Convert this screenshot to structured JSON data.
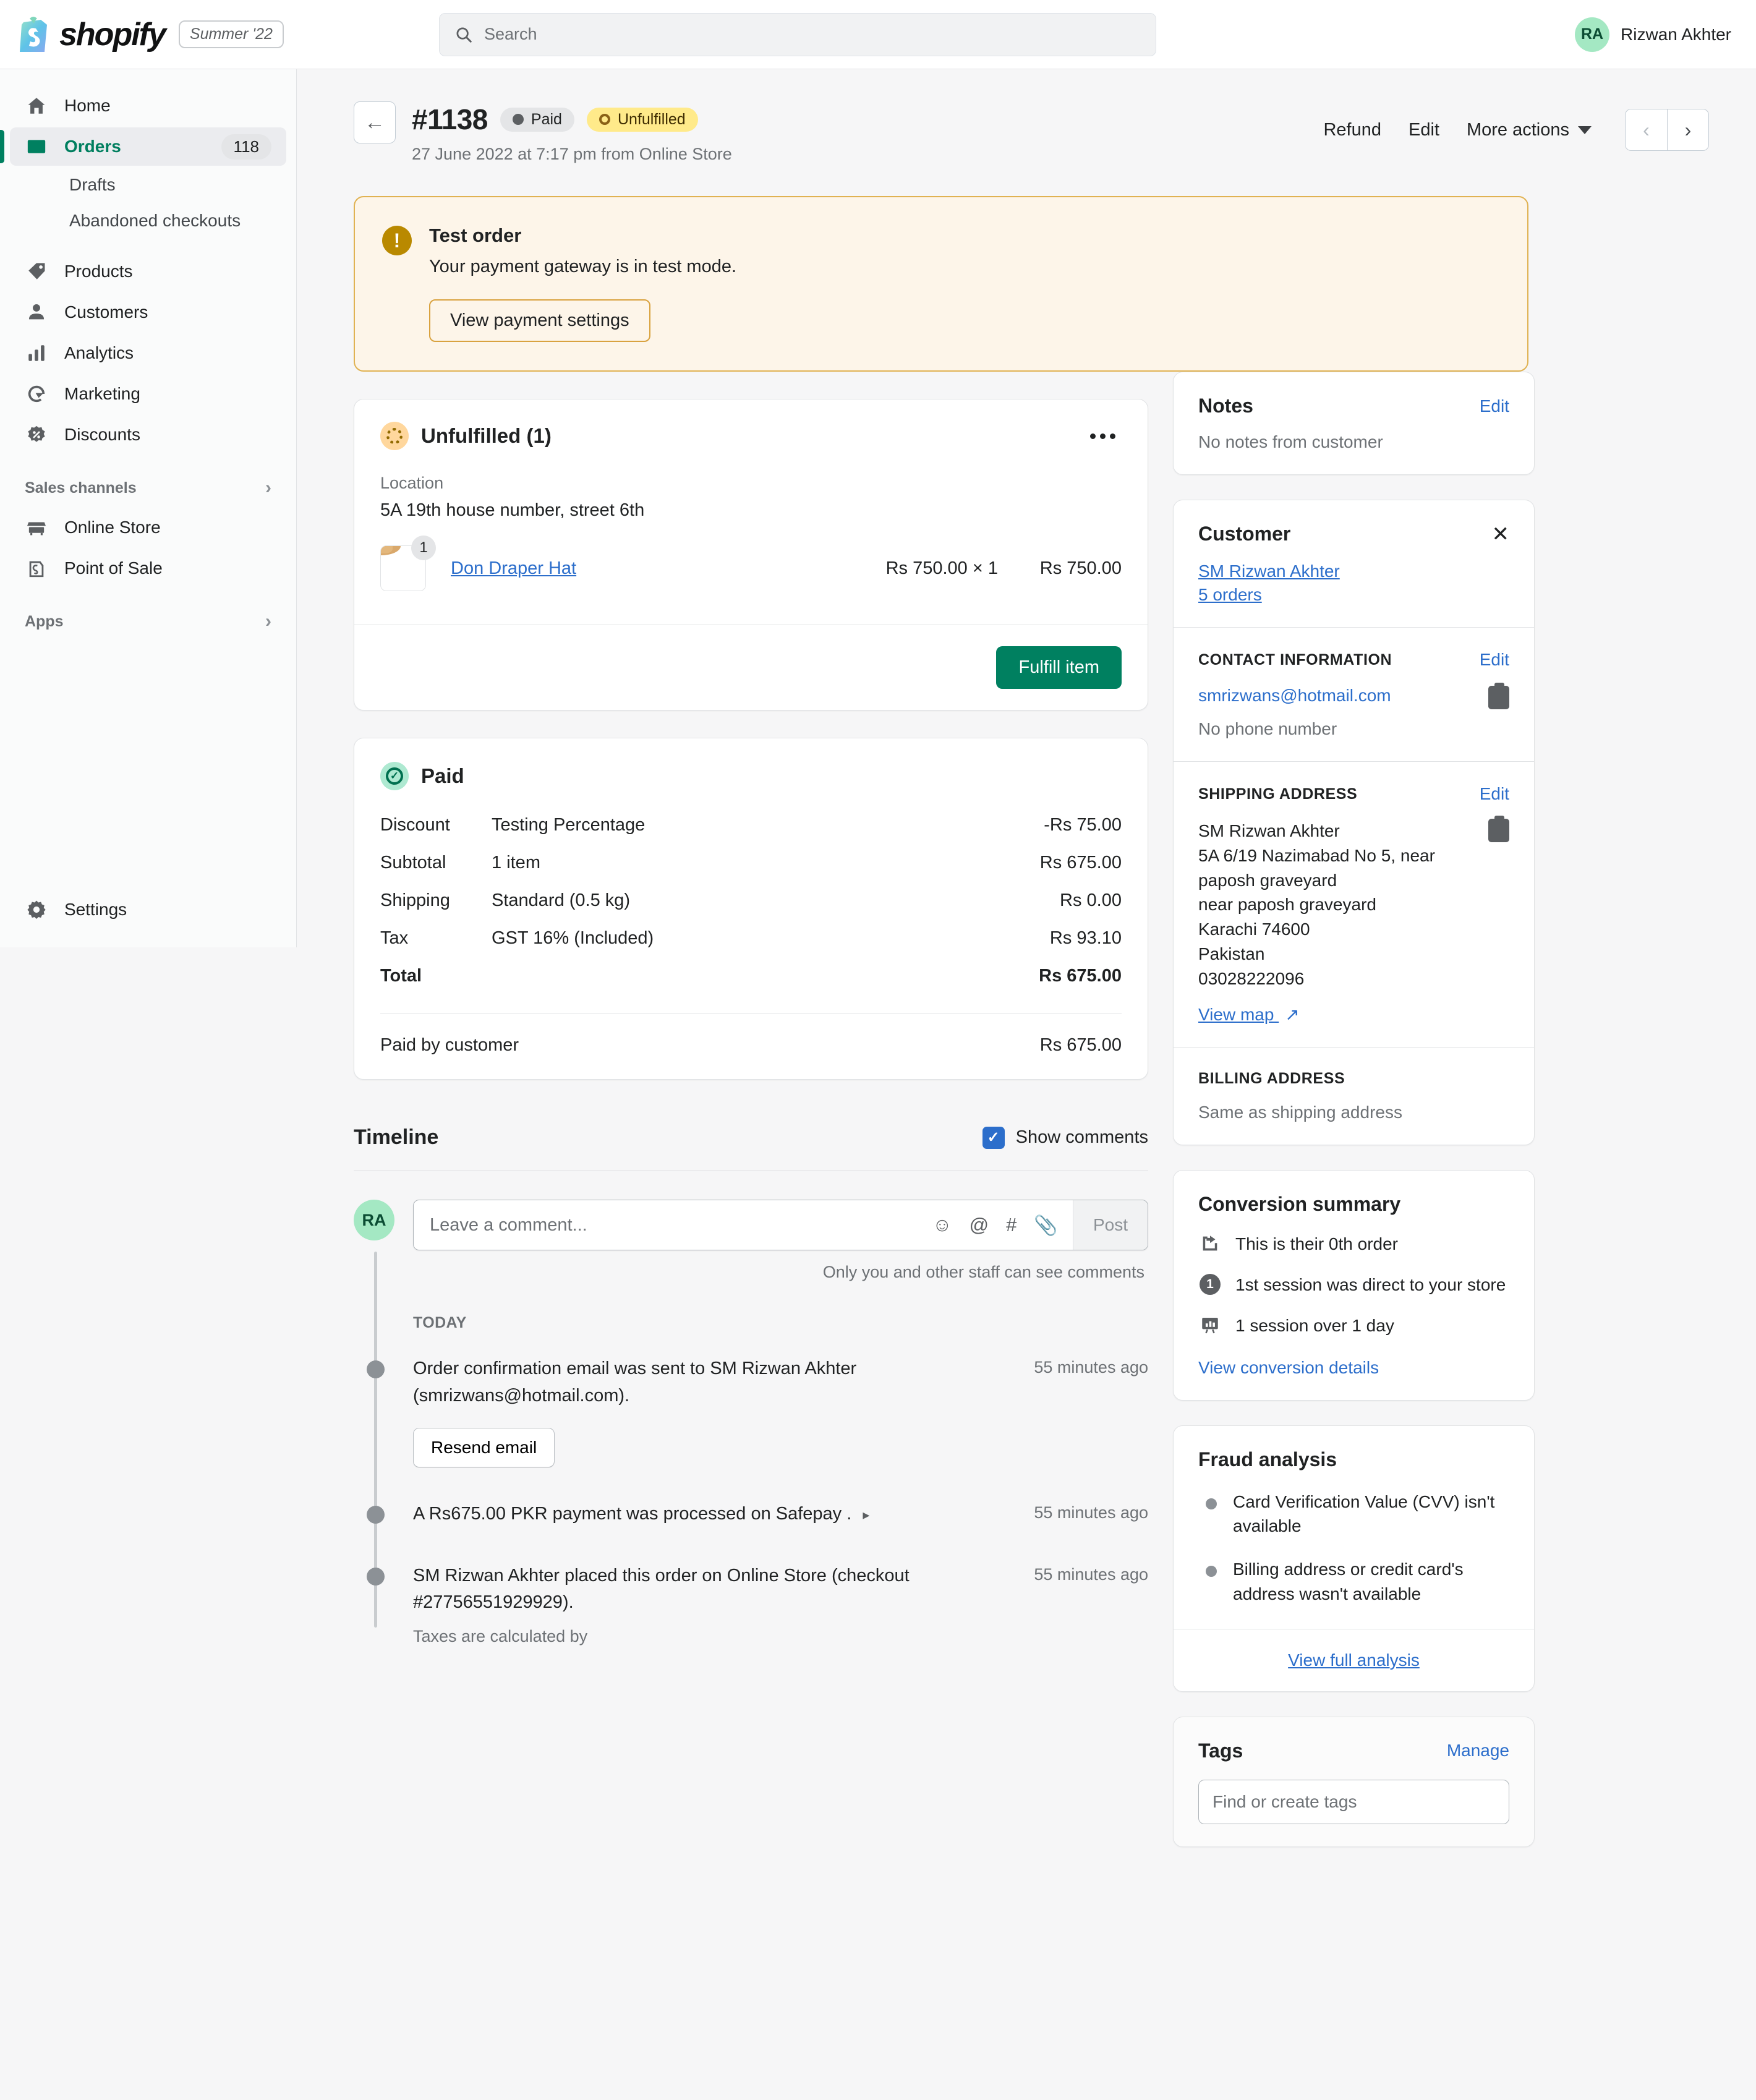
{
  "topbar": {
    "logo_word": "shopify",
    "release_pill": "Summer '22",
    "search_placeholder": "Search",
    "user_initials": "RA",
    "user_name": "Rizwan Akhter"
  },
  "sidebar": {
    "items": [
      {
        "label": "Home",
        "icon": "home-icon"
      },
      {
        "label": "Orders",
        "icon": "orders-icon",
        "badge": "118",
        "active": true
      },
      {
        "label": "Drafts",
        "sub": true
      },
      {
        "label": "Abandoned checkouts",
        "sub": true
      },
      {
        "label": "Products",
        "icon": "tag-icon"
      },
      {
        "label": "Customers",
        "icon": "person-icon"
      },
      {
        "label": "Analytics",
        "icon": "bars-icon"
      },
      {
        "label": "Marketing",
        "icon": "target-icon"
      },
      {
        "label": "Discounts",
        "icon": "discount-icon"
      }
    ],
    "sales_channels_label": "Sales channels",
    "channels": [
      {
        "label": "Online Store",
        "icon": "store-icon"
      },
      {
        "label": "Point of Sale",
        "icon": "pos-icon"
      }
    ],
    "apps_label": "Apps",
    "settings_label": "Settings"
  },
  "order": {
    "number": "#1138",
    "badge_paid": "Paid",
    "badge_fulfillment": "Unfulfilled",
    "date_line": "27 June 2022 at 7:17 pm from Online Store",
    "actions": {
      "refund": "Refund",
      "edit": "Edit",
      "more": "More actions",
      "prev": "‹",
      "next": "›"
    }
  },
  "banner": {
    "title": "Test order",
    "text": "Your payment gateway is in test mode.",
    "button": "View payment settings",
    "accent": "#b98900",
    "background": "#fdf5e9"
  },
  "fulfillment": {
    "title": "Unfulfilled (1)",
    "location_label": "Location",
    "location_value": "5A 19th house number, street 6th",
    "items": [
      {
        "name": "Don Draper Hat",
        "quantity": "1",
        "unit_price": "Rs 750.00 × 1",
        "line_total": "Rs 750.00"
      }
    ],
    "fulfill_button": "Fulfill item"
  },
  "payment": {
    "title": "Paid",
    "rows": [
      {
        "label": "Discount",
        "desc": "Testing Percentage",
        "amount": "-Rs 75.00"
      },
      {
        "label": "Subtotal",
        "desc": "1 item",
        "amount": "Rs 675.00"
      },
      {
        "label": "Shipping",
        "desc": "Standard (0.5 kg)",
        "amount": "Rs 0.00"
      },
      {
        "label": "Tax",
        "desc": "GST 16% (Included)",
        "amount": "Rs 93.10"
      },
      {
        "label": "Total",
        "desc": "",
        "amount": "Rs 675.00"
      }
    ],
    "paid_by_customer_label": "Paid by customer",
    "paid_by_customer_amount": "Rs 675.00"
  },
  "timeline": {
    "title": "Timeline",
    "show_comments_label": "Show comments",
    "comment_placeholder": "Leave a comment...",
    "post_label": "Post",
    "privacy_note": "Only you and other staff can see comments",
    "day_label": "TODAY",
    "events": [
      {
        "text": "Order confirmation email was sent to SM Rizwan Akhter (smrizwans@hotmail.com).",
        "time": "55 minutes ago",
        "button": "Resend email"
      },
      {
        "text": "A Rs675.00 PKR payment was processed on Safepay .",
        "time": "55 minutes ago"
      },
      {
        "text": "SM Rizwan Akhter placed this order on Online Store (checkout #27756551929929).",
        "subnote": "Taxes are calculated by",
        "time": "55 minutes ago"
      }
    ]
  },
  "notes": {
    "title": "Notes",
    "edit": "Edit",
    "empty": "No notes from customer"
  },
  "customer": {
    "title": "Customer",
    "name": "SM Rizwan Akhter",
    "orders_link": "5 orders",
    "contact_heading": "CONTACT INFORMATION",
    "contact_edit": "Edit",
    "email": "smrizwans@hotmail.com",
    "phone": "No phone number",
    "shipping_heading": "SHIPPING ADDRESS",
    "shipping_edit": "Edit",
    "shipping_lines": [
      "SM Rizwan Akhter",
      "5A 6/19 Nazimabad No 5, near paposh graveyard",
      "near paposh graveyard",
      "Karachi 74600",
      "Pakistan",
      "03028222096"
    ],
    "view_map": "View map",
    "billing_heading": "BILLING ADDRESS",
    "billing_value": "Same as shipping address"
  },
  "conversion": {
    "title": "Conversion summary",
    "rows": [
      {
        "text": "This is their 0th order",
        "icon": "return-order-icon"
      },
      {
        "text": "1st session was direct to your store",
        "icon": "session-number-icon",
        "num": "1"
      },
      {
        "text": "1 session over 1 day",
        "icon": "chart-board-icon"
      }
    ],
    "link": "View conversion details"
  },
  "fraud": {
    "title": "Fraud analysis",
    "items": [
      "Card Verification Value (CVV) isn't available",
      "Billing address or credit card's address wasn't available"
    ],
    "link": "View full analysis"
  },
  "tags": {
    "title": "Tags",
    "manage": "Manage",
    "placeholder": "Find or create tags"
  }
}
